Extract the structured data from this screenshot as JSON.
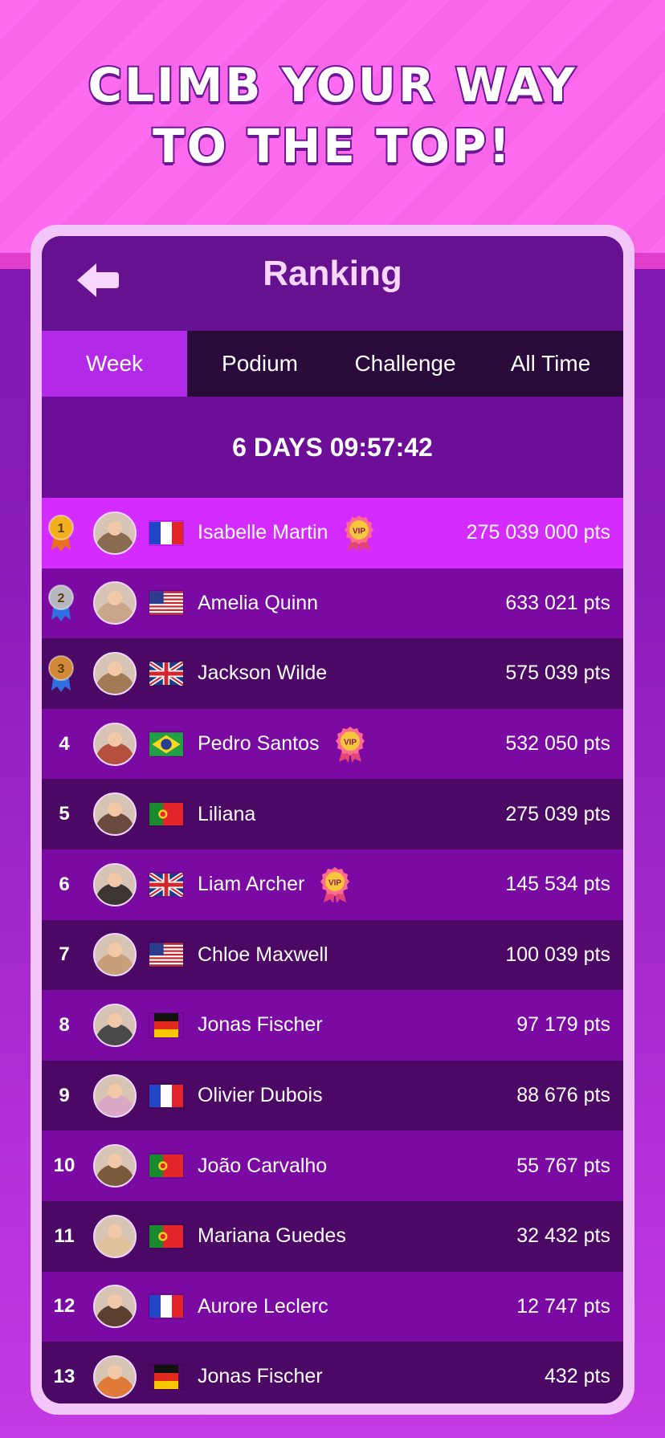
{
  "headline": {
    "line1": "CLIMB YOUR WAY",
    "line2": "TO THE TOP!"
  },
  "header": {
    "title": "Ranking",
    "back_icon": "back-arrow-icon"
  },
  "tabs": [
    {
      "label": "Week",
      "active": true
    },
    {
      "label": "Podium",
      "active": false
    },
    {
      "label": "Challenge",
      "active": false
    },
    {
      "label": "All Time",
      "active": false
    }
  ],
  "timer": "6 DAYS 09:57:42",
  "colors": {
    "active_tab": "#b229e8",
    "highlight_row": "#d42bff",
    "gold": "#f2b01e",
    "silver": "#b7b7c2",
    "bronze": "#d08a3a"
  },
  "leaderboard": [
    {
      "rank": "1",
      "medal": "gold",
      "name": "Isabelle Martin",
      "flag": "fr",
      "vip": true,
      "points": "275 039 000 pts"
    },
    {
      "rank": "2",
      "medal": "silver",
      "name": "Amelia Quinn",
      "flag": "us",
      "vip": false,
      "points": "633 021 pts"
    },
    {
      "rank": "3",
      "medal": "bronze",
      "name": "Jackson Wilde",
      "flag": "gb",
      "vip": false,
      "points": "575 039 pts"
    },
    {
      "rank": "4",
      "name": "Pedro Santos",
      "flag": "br",
      "vip": true,
      "points": "532 050 pts"
    },
    {
      "rank": "5",
      "name": "Liliana",
      "flag": "pt",
      "vip": false,
      "points": "275 039 pts"
    },
    {
      "rank": "6",
      "name": "Liam Archer",
      "flag": "gb",
      "vip": true,
      "points": "145 534 pts"
    },
    {
      "rank": "7",
      "name": "Chloe Maxwell",
      "flag": "us",
      "vip": false,
      "points": "100 039 pts"
    },
    {
      "rank": "8",
      "name": "Jonas Fischer",
      "flag": "de",
      "vip": false,
      "points": "97 179 pts"
    },
    {
      "rank": "9",
      "name": "Olivier Dubois",
      "flag": "fr",
      "vip": false,
      "points": "88 676 pts"
    },
    {
      "rank": "10",
      "name": "João Carvalho",
      "flag": "pt",
      "vip": false,
      "points": "55 767 pts"
    },
    {
      "rank": "11",
      "name": "Mariana Guedes",
      "flag": "pt",
      "vip": false,
      "points": "32 432 pts"
    },
    {
      "rank": "12",
      "name": "Aurore Leclerc",
      "flag": "fr",
      "vip": false,
      "points": "12 747 pts"
    },
    {
      "rank": "13",
      "name": "Jonas Fischer",
      "flag": "de",
      "vip": false,
      "points": "432 pts"
    }
  ],
  "vip_label": "VIP"
}
